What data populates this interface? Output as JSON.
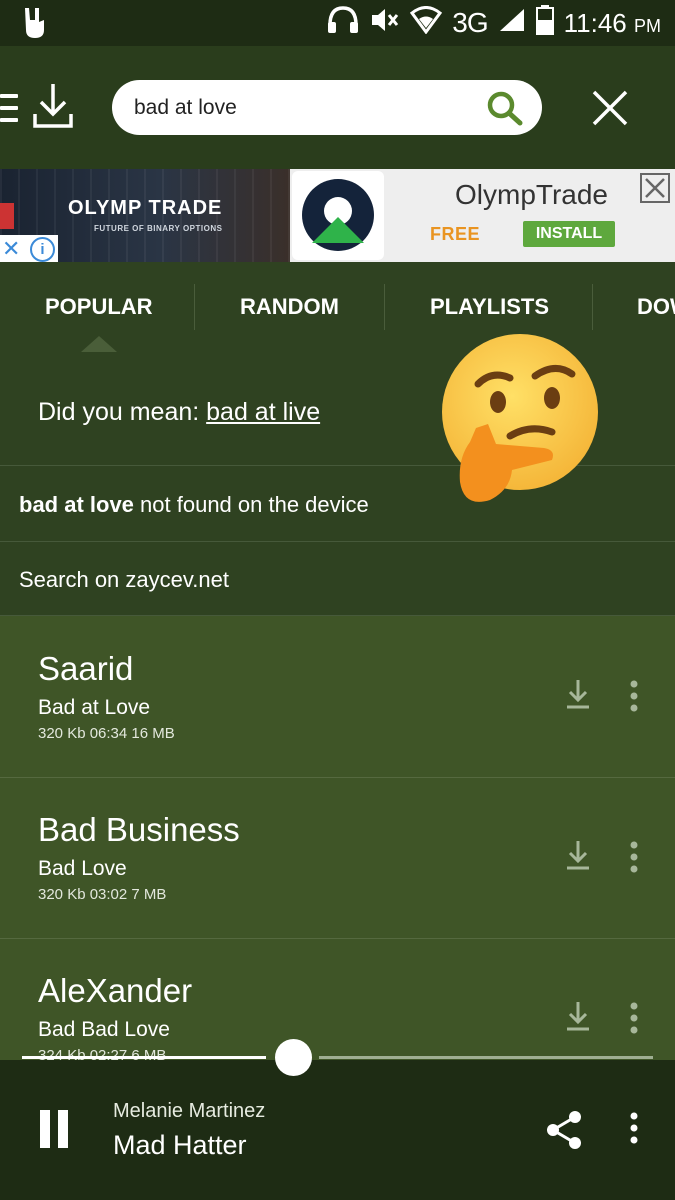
{
  "status_bar": {
    "network": "3G",
    "time": "11:46",
    "ampm": "PM"
  },
  "search": {
    "value": "bad at love"
  },
  "ad": {
    "brand": "OLYMP TRADE",
    "tagline": "FUTURE OF BINARY OPTIONS",
    "title": "OlympTrade",
    "free_label": "FREE",
    "install_label": "INSTALL"
  },
  "tabs": [
    {
      "label": "POPULAR"
    },
    {
      "label": "RANDOM"
    },
    {
      "label": "PLAYLISTS"
    },
    {
      "label": "DOW"
    }
  ],
  "suggestion": {
    "prefix": "Did you mean: ",
    "link": "bad at live"
  },
  "not_found": {
    "query": "bad at love",
    "suffix": " not found on the device"
  },
  "search_online": "Search on zaycev.net",
  "results": [
    {
      "artist": "Saarid",
      "title": "Bad at Love",
      "meta": "320 Kb  06:34  16 MB"
    },
    {
      "artist": "Bad Business",
      "title": "Bad Love",
      "meta": "320 Kb  03:02  7 MB"
    },
    {
      "artist": "AleXander",
      "title": "Bad Bad Love",
      "meta": "324 Kb  02:27  6 MB"
    }
  ],
  "player": {
    "artist": "Melanie Martinez",
    "title": "Mad Hatter",
    "progress": 0.43
  },
  "colors": {
    "bg": "#2f4221",
    "results_bg": "#3f5527",
    "bar_bg": "#1e2c14",
    "accent_green": "#5ea83d",
    "ad_orange": "#e99421"
  }
}
